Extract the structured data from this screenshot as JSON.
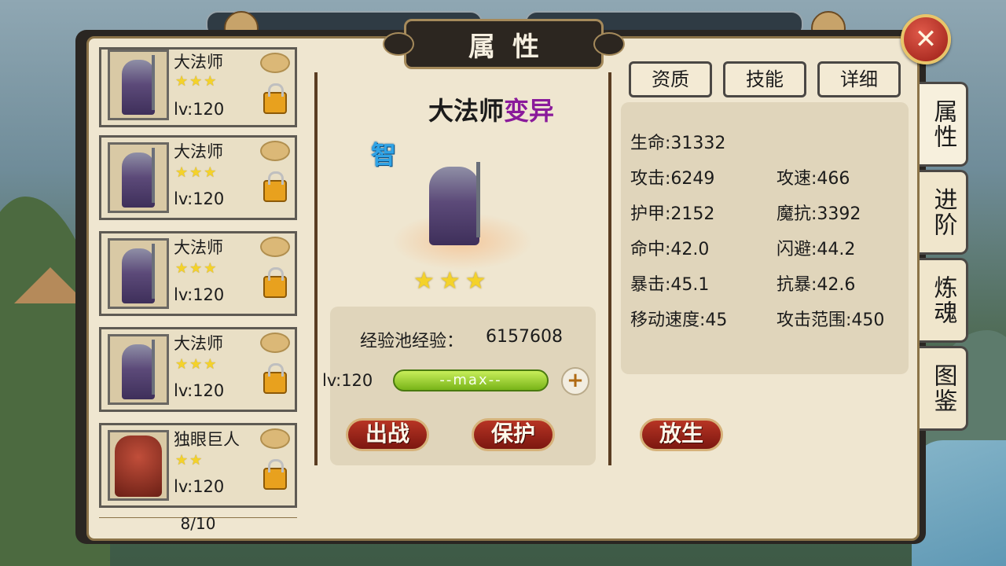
{
  "title": "属性",
  "close_label": "✕",
  "hero_list": [
    {
      "name": "大法师",
      "stars": "★★★",
      "level": "lv:120",
      "type": "mage"
    },
    {
      "name": "大法师",
      "stars": "★★★",
      "level": "lv:120",
      "type": "mage"
    },
    {
      "name": "大法师",
      "stars": "★★★",
      "level": "lv:120",
      "type": "mage"
    },
    {
      "name": "大法师",
      "stars": "★★★",
      "level": "lv:120",
      "type": "mage"
    },
    {
      "name": "独眼巨人",
      "stars": "★★",
      "level": "lv:120",
      "type": "giant"
    }
  ],
  "list_count": "8/10",
  "detail": {
    "name": "大法师",
    "mutation": "变异",
    "class_badge": "智",
    "stars": "★★★",
    "exp_label": "经验池经验：",
    "exp_value": "6157608",
    "level": "lv:120",
    "exp_bar_text": "--max--",
    "plus": "+"
  },
  "buttons": {
    "fight": "出战",
    "protect": "保护",
    "release": "放生"
  },
  "sub_tabs": [
    "资质",
    "技能",
    "详细"
  ],
  "stats": {
    "hp": "生命:31332",
    "atk": "攻击:6249",
    "atk_speed": "攻速:466",
    "armor": "护甲:2152",
    "magic_res": "魔抗:3392",
    "hit": "命中:42.0",
    "dodge": "闪避:44.2",
    "crit": "暴击:45.1",
    "anti_crit": "抗暴:42.6",
    "move_speed": "移动速度:45",
    "atk_range": "攻击范围:450"
  },
  "side_tabs": [
    "属性",
    "进阶",
    "炼魂",
    "图鉴"
  ],
  "colors": {
    "mutation": "#8a1a9b",
    "class_badge": "#2fa3e6",
    "star": "#f4d22a",
    "button_red": "#b73424",
    "exp_bar": "#9ed22f"
  }
}
